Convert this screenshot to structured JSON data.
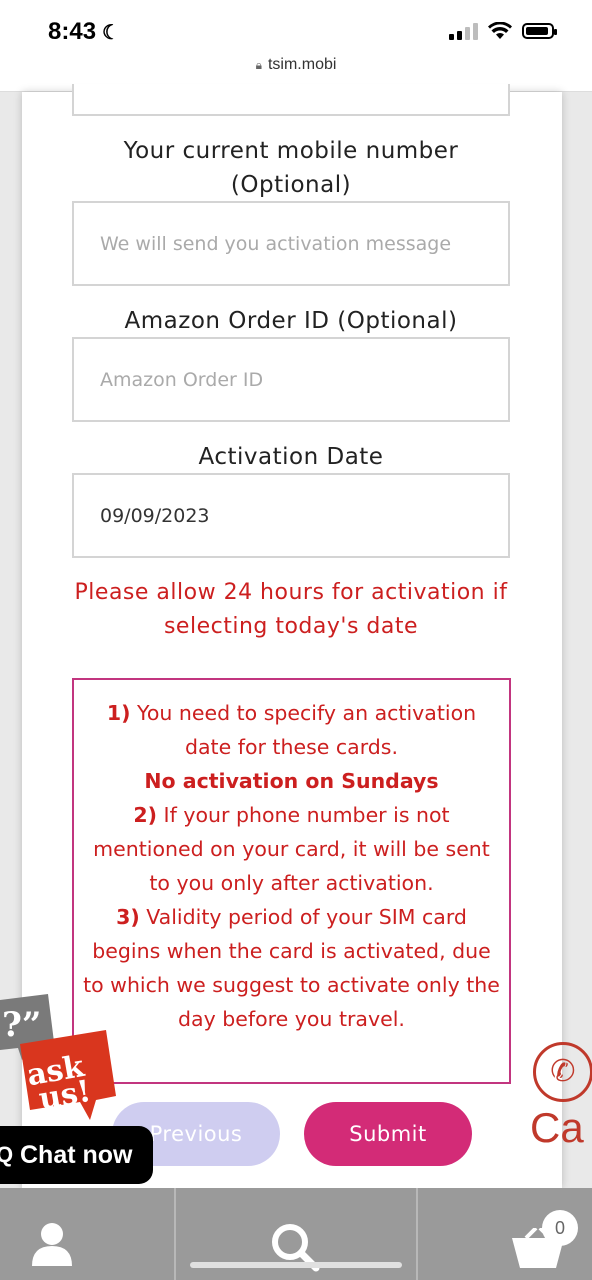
{
  "status_bar": {
    "time": "8:43",
    "signal_bars_filled": 2,
    "battery_level": 0.9
  },
  "url_bar": {
    "url": "tsim.mobi"
  },
  "form": {
    "mobile_label": "Your current mobile number (Optional)",
    "mobile_placeholder": "We will send you activation message",
    "amazon_label": "Amazon Order ID (Optional)",
    "amazon_placeholder": "Amazon Order ID",
    "activation_label": "Activation Date",
    "activation_value": "09/09/2023",
    "warning": "Please allow 24 hours for activation if selecting today's date",
    "notice": {
      "n1": "1)",
      "t1": " You need to specify an activation date for these cards.",
      "bold": "No activation on Sundays",
      "n2": "2)",
      "t2": " If your phone number is not mentioned on your card, it will be sent to you only after activation.",
      "n3": "3)",
      "t3": " Validity period of your SIM card begins when the card is activated, due to which we suggest to activate only the day before you travel."
    },
    "previous_label": "Previous",
    "submit_label": "Submit"
  },
  "widgets": {
    "ask_quote": "?”",
    "ask_text_1": "ask",
    "ask_text_2": "us!",
    "chat_now": "Chat now",
    "call_text": "Ca"
  },
  "bottom_nav": {
    "cart_count": "0"
  },
  "colors": {
    "accent": "#d32b77",
    "warning": "#cc1f1f",
    "notice_border": "#c2357f"
  }
}
